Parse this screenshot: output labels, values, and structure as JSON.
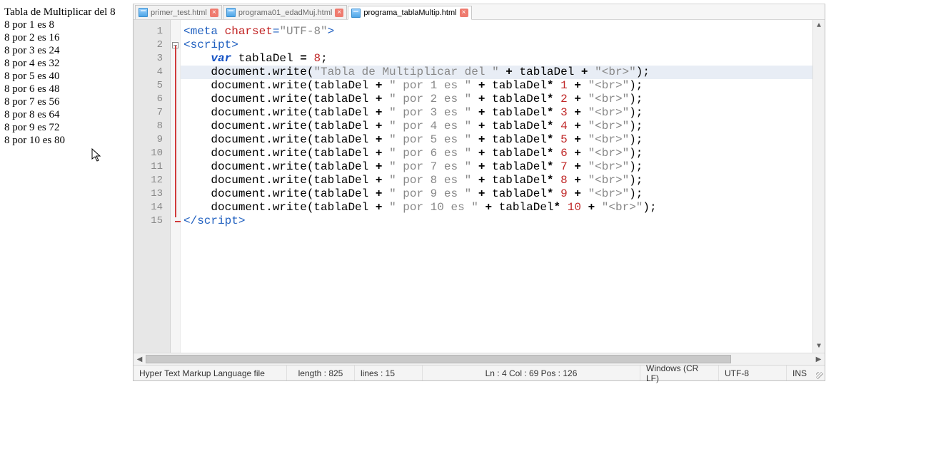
{
  "output": {
    "title": "Tabla de Multiplicar del 8",
    "lines": [
      "8 por 1 es 8",
      "8 por 2 es 16",
      "8 por 3 es 24",
      "8 por 4 es 32",
      "8 por 5 es 40",
      "8 por 6 es 48",
      "8 por 7 es 56",
      "8 por 8 es 64",
      "8 por 9 es 72",
      "8 por 10 es 80"
    ]
  },
  "tabs": [
    {
      "label": "primer_test.html",
      "active": false
    },
    {
      "label": "programa01_edadMuj.html",
      "active": false
    },
    {
      "label": "programa_tablaMultip.html",
      "active": true
    }
  ],
  "gutter_lines": 15,
  "code": {
    "lines": [
      [
        [
          "tag",
          "<meta "
        ],
        [
          "attr",
          "charset"
        ],
        [
          "tag",
          "="
        ],
        [
          "str",
          "\"UTF-8\""
        ],
        [
          "tag",
          ">"
        ]
      ],
      [
        [
          "tag",
          "<script>"
        ]
      ],
      [
        [
          "plain",
          "    "
        ],
        [
          "kw",
          "var"
        ],
        [
          "plain",
          " tablaDel "
        ],
        [
          "op",
          "="
        ],
        [
          "plain",
          " "
        ],
        [
          "num",
          "8"
        ],
        [
          "plain",
          ";"
        ]
      ],
      [
        [
          "plain",
          "    document.write("
        ],
        [
          "str",
          "\"Tabla de Multiplicar del \""
        ],
        [
          "plain",
          " "
        ],
        [
          "op",
          "+"
        ],
        [
          "plain",
          " tablaDel "
        ],
        [
          "op",
          "+"
        ],
        [
          "plain",
          " "
        ],
        [
          "str",
          "\"<br>\""
        ],
        [
          "plain",
          ");"
        ]
      ],
      [
        [
          "plain",
          "    document.write(tablaDel "
        ],
        [
          "op",
          "+"
        ],
        [
          "plain",
          " "
        ],
        [
          "str",
          "\" por 1 es \""
        ],
        [
          "plain",
          " "
        ],
        [
          "op",
          "+"
        ],
        [
          "plain",
          " tablaDel"
        ],
        [
          "op",
          "*"
        ],
        [
          "plain",
          " "
        ],
        [
          "num",
          "1"
        ],
        [
          "plain",
          " "
        ],
        [
          "op",
          "+"
        ],
        [
          "plain",
          " "
        ],
        [
          "str",
          "\"<br>\""
        ],
        [
          "plain",
          ");"
        ]
      ],
      [
        [
          "plain",
          "    document.write(tablaDel "
        ],
        [
          "op",
          "+"
        ],
        [
          "plain",
          " "
        ],
        [
          "str",
          "\" por 2 es \""
        ],
        [
          "plain",
          " "
        ],
        [
          "op",
          "+"
        ],
        [
          "plain",
          " tablaDel"
        ],
        [
          "op",
          "*"
        ],
        [
          "plain",
          " "
        ],
        [
          "num",
          "2"
        ],
        [
          "plain",
          " "
        ],
        [
          "op",
          "+"
        ],
        [
          "plain",
          " "
        ],
        [
          "str",
          "\"<br>\""
        ],
        [
          "plain",
          ");"
        ]
      ],
      [
        [
          "plain",
          "    document.write(tablaDel "
        ],
        [
          "op",
          "+"
        ],
        [
          "plain",
          " "
        ],
        [
          "str",
          "\" por 3 es \""
        ],
        [
          "plain",
          " "
        ],
        [
          "op",
          "+"
        ],
        [
          "plain",
          " tablaDel"
        ],
        [
          "op",
          "*"
        ],
        [
          "plain",
          " "
        ],
        [
          "num",
          "3"
        ],
        [
          "plain",
          " "
        ],
        [
          "op",
          "+"
        ],
        [
          "plain",
          " "
        ],
        [
          "str",
          "\"<br>\""
        ],
        [
          "plain",
          ");"
        ]
      ],
      [
        [
          "plain",
          "    document.write(tablaDel "
        ],
        [
          "op",
          "+"
        ],
        [
          "plain",
          " "
        ],
        [
          "str",
          "\" por 4 es \""
        ],
        [
          "plain",
          " "
        ],
        [
          "op",
          "+"
        ],
        [
          "plain",
          " tablaDel"
        ],
        [
          "op",
          "*"
        ],
        [
          "plain",
          " "
        ],
        [
          "num",
          "4"
        ],
        [
          "plain",
          " "
        ],
        [
          "op",
          "+"
        ],
        [
          "plain",
          " "
        ],
        [
          "str",
          "\"<br>\""
        ],
        [
          "plain",
          ");"
        ]
      ],
      [
        [
          "plain",
          "    document.write(tablaDel "
        ],
        [
          "op",
          "+"
        ],
        [
          "plain",
          " "
        ],
        [
          "str",
          "\" por 5 es \""
        ],
        [
          "plain",
          " "
        ],
        [
          "op",
          "+"
        ],
        [
          "plain",
          " tablaDel"
        ],
        [
          "op",
          "*"
        ],
        [
          "plain",
          " "
        ],
        [
          "num",
          "5"
        ],
        [
          "plain",
          " "
        ],
        [
          "op",
          "+"
        ],
        [
          "plain",
          " "
        ],
        [
          "str",
          "\"<br>\""
        ],
        [
          "plain",
          ");"
        ]
      ],
      [
        [
          "plain",
          "    document.write(tablaDel "
        ],
        [
          "op",
          "+"
        ],
        [
          "plain",
          " "
        ],
        [
          "str",
          "\" por 6 es \""
        ],
        [
          "plain",
          " "
        ],
        [
          "op",
          "+"
        ],
        [
          "plain",
          " tablaDel"
        ],
        [
          "op",
          "*"
        ],
        [
          "plain",
          " "
        ],
        [
          "num",
          "6"
        ],
        [
          "plain",
          " "
        ],
        [
          "op",
          "+"
        ],
        [
          "plain",
          " "
        ],
        [
          "str",
          "\"<br>\""
        ],
        [
          "plain",
          ");"
        ]
      ],
      [
        [
          "plain",
          "    document.write(tablaDel "
        ],
        [
          "op",
          "+"
        ],
        [
          "plain",
          " "
        ],
        [
          "str",
          "\" por 7 es \""
        ],
        [
          "plain",
          " "
        ],
        [
          "op",
          "+"
        ],
        [
          "plain",
          " tablaDel"
        ],
        [
          "op",
          "*"
        ],
        [
          "plain",
          " "
        ],
        [
          "num",
          "7"
        ],
        [
          "plain",
          " "
        ],
        [
          "op",
          "+"
        ],
        [
          "plain",
          " "
        ],
        [
          "str",
          "\"<br>\""
        ],
        [
          "plain",
          ");"
        ]
      ],
      [
        [
          "plain",
          "    document.write(tablaDel "
        ],
        [
          "op",
          "+"
        ],
        [
          "plain",
          " "
        ],
        [
          "str",
          "\" por 8 es \""
        ],
        [
          "plain",
          " "
        ],
        [
          "op",
          "+"
        ],
        [
          "plain",
          " tablaDel"
        ],
        [
          "op",
          "*"
        ],
        [
          "plain",
          " "
        ],
        [
          "num",
          "8"
        ],
        [
          "plain",
          " "
        ],
        [
          "op",
          "+"
        ],
        [
          "plain",
          " "
        ],
        [
          "str",
          "\"<br>\""
        ],
        [
          "plain",
          ");"
        ]
      ],
      [
        [
          "plain",
          "    document.write(tablaDel "
        ],
        [
          "op",
          "+"
        ],
        [
          "plain",
          " "
        ],
        [
          "str",
          "\" por 9 es \""
        ],
        [
          "plain",
          " "
        ],
        [
          "op",
          "+"
        ],
        [
          "plain",
          " tablaDel"
        ],
        [
          "op",
          "*"
        ],
        [
          "plain",
          " "
        ],
        [
          "num",
          "9"
        ],
        [
          "plain",
          " "
        ],
        [
          "op",
          "+"
        ],
        [
          "plain",
          " "
        ],
        [
          "str",
          "\"<br>\""
        ],
        [
          "plain",
          ");"
        ]
      ],
      [
        [
          "plain",
          "    document.write(tablaDel "
        ],
        [
          "op",
          "+"
        ],
        [
          "plain",
          " "
        ],
        [
          "str",
          "\" por 10 es \""
        ],
        [
          "plain",
          " "
        ],
        [
          "op",
          "+"
        ],
        [
          "plain",
          " tablaDel"
        ],
        [
          "op",
          "*"
        ],
        [
          "plain",
          " "
        ],
        [
          "num",
          "10"
        ],
        [
          "plain",
          " "
        ],
        [
          "op",
          "+"
        ],
        [
          "plain",
          " "
        ],
        [
          "str",
          "\"<br>\""
        ],
        [
          "plain",
          ");"
        ]
      ],
      [
        [
          "tag",
          "</script"
        ],
        [
          "tag",
          ">"
        ]
      ]
    ],
    "highlight_line": 4
  },
  "status": {
    "filetype": "Hyper Text Markup Language file",
    "length": "length : 825",
    "lines": "lines : 15",
    "pos": "Ln : 4    Col : 69    Pos : 126",
    "eol": "Windows (CR LF)",
    "encoding": "UTF-8",
    "mode": "INS"
  }
}
